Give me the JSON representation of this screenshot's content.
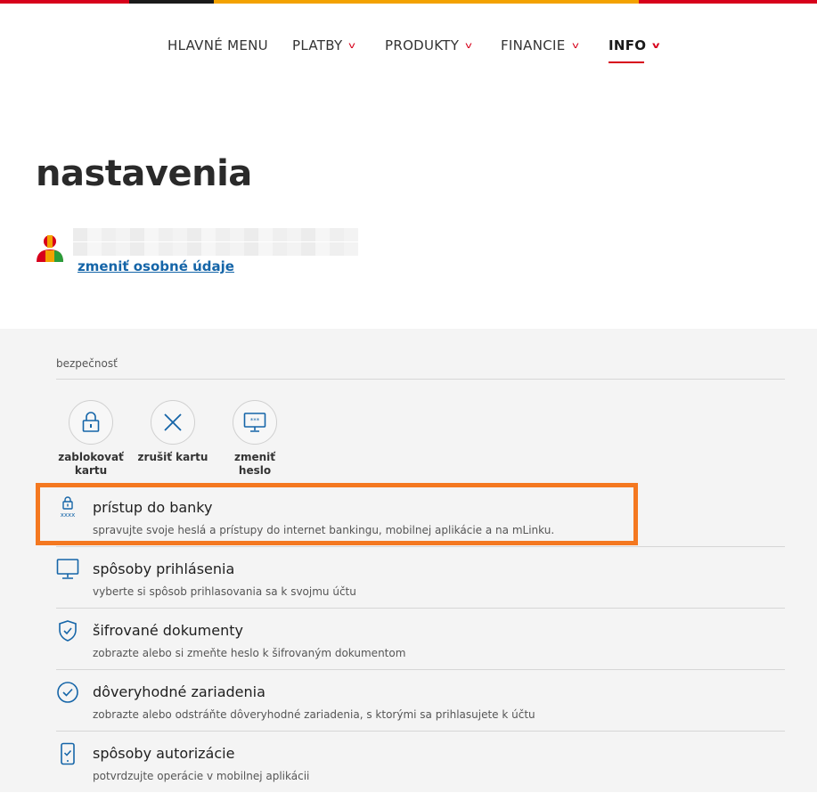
{
  "brand_colors": {
    "red": "#d7001b",
    "orange": "#f3a200",
    "dark": "#1a1a1a",
    "link": "#1565a8",
    "highlight": "#f47820"
  },
  "nav": {
    "items": [
      {
        "label": "HLAVNÉ MENU",
        "dropdown": false,
        "active": false
      },
      {
        "label": "PLATBY",
        "dropdown": true,
        "active": false
      },
      {
        "label": "PRODUKTY",
        "dropdown": true,
        "active": false
      },
      {
        "label": "FINANCIE",
        "dropdown": true,
        "active": false
      },
      {
        "label": "INFO",
        "dropdown": true,
        "active": true
      }
    ],
    "chevron_icon": "chevron-down-icon"
  },
  "page": {
    "title": "nastavenia",
    "profile": {
      "avatar_icon": "user-avatar-icon",
      "edit_link": "zmeniť osobné údaje"
    }
  },
  "security": {
    "section_label": "bezpečnosť",
    "quick_actions": [
      {
        "label": "zablokovať kartu",
        "icon": "lock-icon"
      },
      {
        "label": "zrušiť kartu",
        "icon": "close-icon"
      },
      {
        "label": "zmeniť heslo",
        "icon": "password-screen-icon"
      }
    ],
    "rows": [
      {
        "title": "prístup do banky",
        "desc": "spravujte svoje heslá a prístupy do internet bankingu, mobilnej aplikácie a na mLinku.",
        "icon": "lock-password-icon",
        "highlighted": true
      },
      {
        "title": "spôsoby prihlásenia",
        "desc": "vyberte si spôsob prihlasovania sa k svojmu účtu",
        "icon": "monitor-icon",
        "highlighted": false
      },
      {
        "title": "šifrované dokumenty",
        "desc": "zobrazte alebo si zmeňte heslo k šifrovaným dokumentom",
        "icon": "shield-check-icon",
        "highlighted": false
      },
      {
        "title": "dôveryhodné zariadenia",
        "desc": "zobrazte alebo odstráňte dôveryhodné zariadenia, s ktorými sa prihlasujete k účtu",
        "icon": "check-circle-icon",
        "highlighted": false
      },
      {
        "title": "spôsoby autorizácie",
        "desc": "potvrdzujte operácie v mobilnej aplikácii",
        "icon": "phone-check-icon",
        "highlighted": false
      }
    ]
  }
}
